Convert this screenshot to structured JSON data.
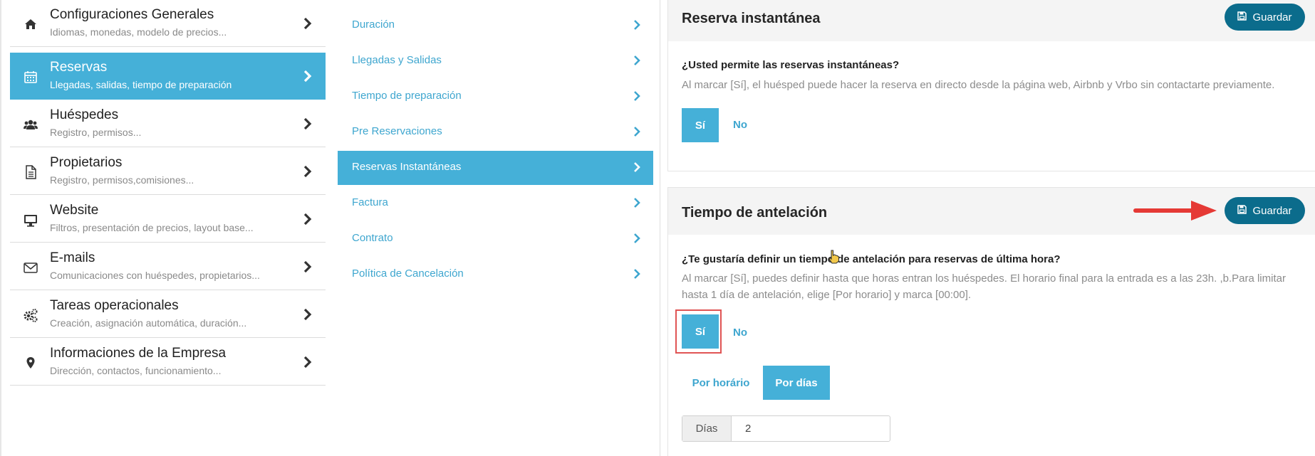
{
  "colors": {
    "accent": "#45b0d8",
    "save_button": "#0b6c8c",
    "link": "#3ea6cf",
    "annotation": "#e53935"
  },
  "left_menu": {
    "items": [
      {
        "title": "Configuraciones Generales",
        "subtitle": "Idiomas, monedas, modelo de precios...",
        "icon": "home-icon",
        "active": false
      },
      {
        "title": "Reservas",
        "subtitle": "Llegadas, salidas, tiempo de preparación",
        "icon": "calendar-icon",
        "active": true
      },
      {
        "title": "Huéspedes",
        "subtitle": "Registro, permisos...",
        "icon": "users-icon",
        "active": false
      },
      {
        "title": "Propietarios",
        "subtitle": "Registro, permisos,comisiones...",
        "icon": "document-icon",
        "active": false
      },
      {
        "title": "Website",
        "subtitle": "Filtros, presentación de precios, layout base...",
        "icon": "monitor-icon",
        "active": false
      },
      {
        "title": "E-mails",
        "subtitle": "Comunicaciones con huéspedes, propietarios...",
        "icon": "envelope-icon",
        "active": false
      },
      {
        "title": "Tareas operacionales",
        "subtitle": "Creación, asignación automática, duración...",
        "icon": "gears-icon",
        "active": false
      },
      {
        "title": "Informaciones de la Empresa",
        "subtitle": "Dirección, contactos, funcionamiento...",
        "icon": "map-pin-icon",
        "active": false
      }
    ]
  },
  "sub_menu": {
    "items": [
      {
        "label": "Duración",
        "active": false
      },
      {
        "label": "Llegadas y Salidas",
        "active": false
      },
      {
        "label": "Tiempo de preparación",
        "active": false
      },
      {
        "label": "Pre Reservaciones",
        "active": false
      },
      {
        "label": "Reservas Instantáneas",
        "active": true
      },
      {
        "label": "Factura",
        "active": false
      },
      {
        "label": "Contrato",
        "active": false
      },
      {
        "label": "Política de Cancelación",
        "active": false
      }
    ]
  },
  "instant_booking": {
    "title": "Reserva instantánea",
    "save_label": "Guardar",
    "question": "¿Usted permite las reservas instantáneas?",
    "description": "Al marcar [Sí], el huésped puede hacer la reserva en directo desde la página web, Airbnb y Vrbo sin contactarte previamente.",
    "yes_label": "Sí",
    "no_label": "No",
    "selected": "Sí"
  },
  "lead_time": {
    "title": "Tiempo de antelación",
    "save_label": "Guardar",
    "question": "¿Te gustaría definir un tiempo de antelación para reservas de última hora?",
    "description": "Al marcar [Sí], puedes definir hasta que horas entran los huéspedes. El horario final para la entrada es a las 23h. ,b.Para limitar hasta 1 día de antelación, elige [Por horario] y marca [00:00].",
    "yes_label": "Sí",
    "no_label": "No",
    "selected": "Sí",
    "mode_options": [
      "Por horário",
      "Por días"
    ],
    "selected_mode": "Por días",
    "days_label": "Días",
    "days_value": "2"
  }
}
